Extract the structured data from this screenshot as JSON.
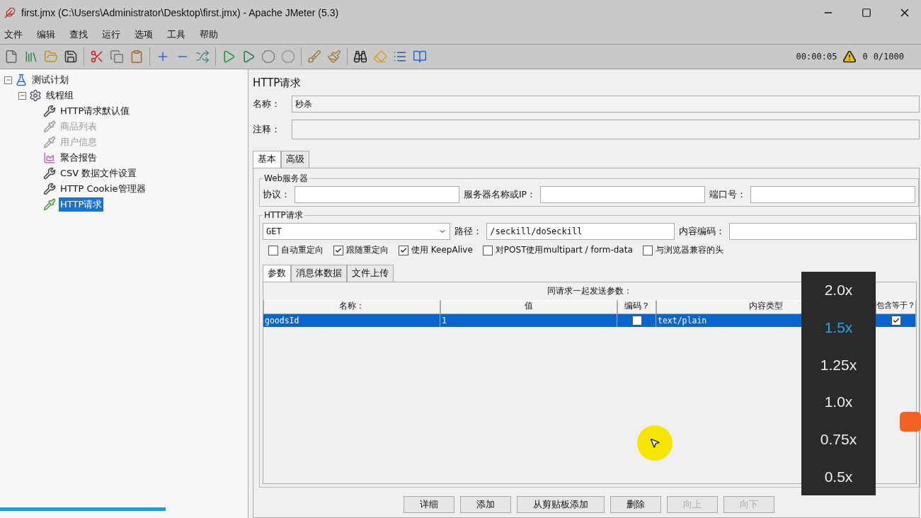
{
  "window": {
    "title": "first.jmx (C:\\Users\\Administrator\\Desktop\\first.jmx) - Apache JMeter (5.3)"
  },
  "menu": [
    "文件",
    "编辑",
    "查找",
    "运行",
    "选项",
    "工具",
    "帮助"
  ],
  "status": {
    "elapsed": "00:00:05",
    "warnings": "0",
    "threads": "0/1000"
  },
  "tree": [
    {
      "label": "测试计划",
      "kind": "flask",
      "expanded": true,
      "disabled": false,
      "selected": false,
      "children": [
        {
          "label": "线程组",
          "kind": "gear",
          "expanded": true,
          "disabled": false,
          "selected": false,
          "children": [
            {
              "label": "HTTP请求默认值",
              "kind": "tools",
              "disabled": false,
              "selected": false
            },
            {
              "label": "商品列表",
              "kind": "pipette",
              "disabled": true,
              "selected": false
            },
            {
              "label": "用户信息",
              "kind": "pipette",
              "disabled": true,
              "selected": false
            },
            {
              "label": "聚合报告",
              "kind": "chart",
              "disabled": false,
              "selected": false
            },
            {
              "label": "CSV 数据文件设置",
              "kind": "tools",
              "disabled": false,
              "selected": false
            },
            {
              "label": "HTTP Cookie管理器",
              "kind": "tools",
              "disabled": false,
              "selected": false
            },
            {
              "label": "HTTP请求",
              "kind": "pipette",
              "disabled": false,
              "selected": true
            }
          ]
        }
      ]
    }
  ],
  "panel": {
    "title": "HTTP请求",
    "name_label": "名称：",
    "name_value": "秒杀",
    "comment_label": "注释：",
    "tabs": [
      {
        "label": "基本",
        "selected": true
      },
      {
        "label": "高级",
        "selected": false
      }
    ],
    "web_server": {
      "legend": "Web服务器",
      "protocol_label": "协议：",
      "server_label": "服务器名称或IP：",
      "port_label": "端口号："
    },
    "http_request": {
      "legend": "HTTP请求",
      "method": "GET",
      "path_label": "路径：",
      "path": "/seckill/doSeckill",
      "encoding_label": "内容编码：",
      "options": [
        {
          "label": "自动重定向",
          "checked": false
        },
        {
          "label": "跟随重定向",
          "checked": true
        },
        {
          "label": "使用 KeepAlive",
          "checked": true
        },
        {
          "label": "对POST使用multipart / form-data",
          "checked": false
        },
        {
          "label": "与浏览器兼容的头",
          "checked": false
        }
      ],
      "tabs": [
        {
          "label": "参数",
          "selected": true
        },
        {
          "label": "消息体数据",
          "selected": false
        },
        {
          "label": "文件上传",
          "selected": false
        }
      ],
      "caption": "同请求一起发送参数：",
      "columns": [
        "名称：",
        "值",
        "编码？",
        "内容类型",
        "包含等于？"
      ],
      "rows": [
        {
          "name": "goodsId",
          "value": "1",
          "encode": false,
          "content_type": "text/plain",
          "include_equals": true,
          "selected": true
        }
      ]
    },
    "buttons": [
      {
        "label": "详细",
        "disabled": false
      },
      {
        "label": "添加",
        "disabled": false
      },
      {
        "label": "从剪贴板添加",
        "disabled": false
      },
      {
        "label": "删除",
        "disabled": false
      },
      {
        "label": "向上",
        "disabled": true
      },
      {
        "label": "向下",
        "disabled": true
      }
    ]
  },
  "speed_menu": [
    {
      "label": "2.0x",
      "selected": false
    },
    {
      "label": "1.5x",
      "selected": true
    },
    {
      "label": "1.25x",
      "selected": false
    },
    {
      "label": "1.0x",
      "selected": false
    },
    {
      "label": "0.75x",
      "selected": false
    },
    {
      "label": "0.5x",
      "selected": false
    }
  ],
  "player": {
    "progress": {
      "level": 0.18
    }
  }
}
